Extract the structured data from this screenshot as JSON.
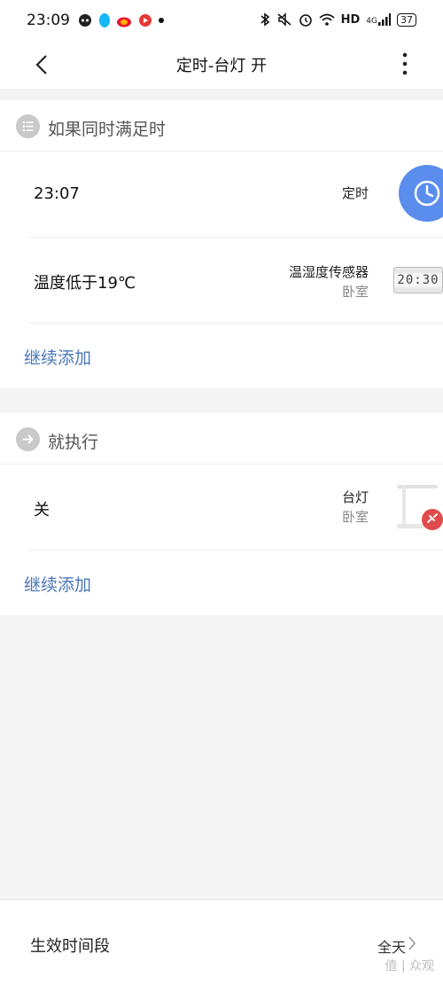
{
  "status_bar": {
    "time": "23:09",
    "left_icons": [
      "ghost-app-icon",
      "qq-icon",
      "weibo-icon",
      "video-app-icon",
      "dot-icon"
    ],
    "right_icons": [
      "bluetooth-icon",
      "mute-icon",
      "alarm-icon",
      "wifi-icon"
    ],
    "hd": "HD",
    "network": "4G",
    "battery": "37"
  },
  "nav": {
    "title": "定时-台灯 开"
  },
  "conditions": {
    "header": "如果同时满足时",
    "items": [
      {
        "main": "23:07",
        "desc": "定时",
        "sub": "",
        "icon": "clock-icon"
      },
      {
        "main": "温度低于19℃",
        "desc": "温湿度传感器",
        "sub": "卧室",
        "icon": "sensor-device-icon",
        "display": "20:30"
      }
    ],
    "add_label": "继续添加"
  },
  "actions": {
    "header": "就执行",
    "items": [
      {
        "main": "关",
        "desc": "台灯",
        "sub": "卧室",
        "icon": "desk-lamp-icon"
      }
    ],
    "add_label": "继续添加"
  },
  "bottom": {
    "label": "生效时间段",
    "value": "全天",
    "watermark": "值 | 众观"
  },
  "colors": {
    "accent_blue": "#5b8def",
    "link_blue": "#4a78b8",
    "badge_red": "#e04a4a"
  }
}
